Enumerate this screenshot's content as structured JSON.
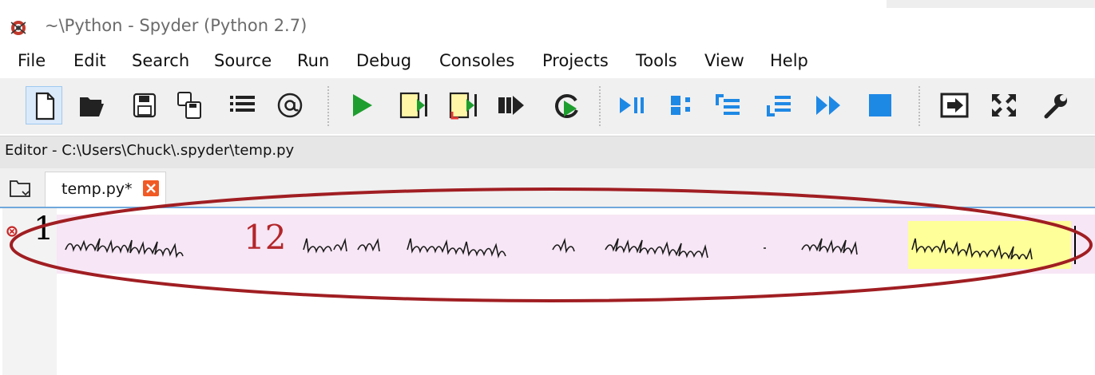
{
  "window": {
    "title": "~\\Python - Spyder (Python 2.7)",
    "app_icon": "spyder-icon"
  },
  "menu": [
    {
      "label": "File"
    },
    {
      "label": "Edit"
    },
    {
      "label": "Search"
    },
    {
      "label": "Source"
    },
    {
      "label": "Run"
    },
    {
      "label": "Debug"
    },
    {
      "label": "Consoles"
    },
    {
      "label": "Projects"
    },
    {
      "label": "Tools"
    },
    {
      "label": "View"
    },
    {
      "label": "Help"
    }
  ],
  "toolbar": {
    "buttons": [
      {
        "icon": "new-file-icon"
      },
      {
        "icon": "open-folder-icon"
      },
      {
        "icon": "save-icon"
      },
      {
        "icon": "save-all-icon"
      },
      {
        "icon": "outline-list-icon"
      },
      {
        "icon": "at-sign-icon"
      },
      {
        "icon": "run-icon"
      },
      {
        "icon": "run-cell-icon"
      },
      {
        "icon": "run-cell-advance-icon"
      },
      {
        "icon": "run-selection-icon"
      },
      {
        "icon": "rerun-icon"
      },
      {
        "icon": "debug-icon"
      },
      {
        "icon": "step-icon"
      },
      {
        "icon": "step-into-icon"
      },
      {
        "icon": "step-return-icon"
      },
      {
        "icon": "continue-icon"
      },
      {
        "icon": "stop-icon"
      },
      {
        "icon": "maximize-pane-icon"
      },
      {
        "icon": "fullscreen-icon"
      },
      {
        "icon": "preferences-wrench-icon"
      }
    ]
  },
  "editor": {
    "pane_title": "Editor - C:\\Users\\Chuck\\.spyder\\temp.py",
    "tab_label": "temp.py*",
    "line_number": "1",
    "code_number": "12",
    "colors": {
      "line_highlight": "#f7e6f5",
      "word_highlight": "#ffff99",
      "number": "#b3262a",
      "annotation": "#a01e22"
    }
  }
}
